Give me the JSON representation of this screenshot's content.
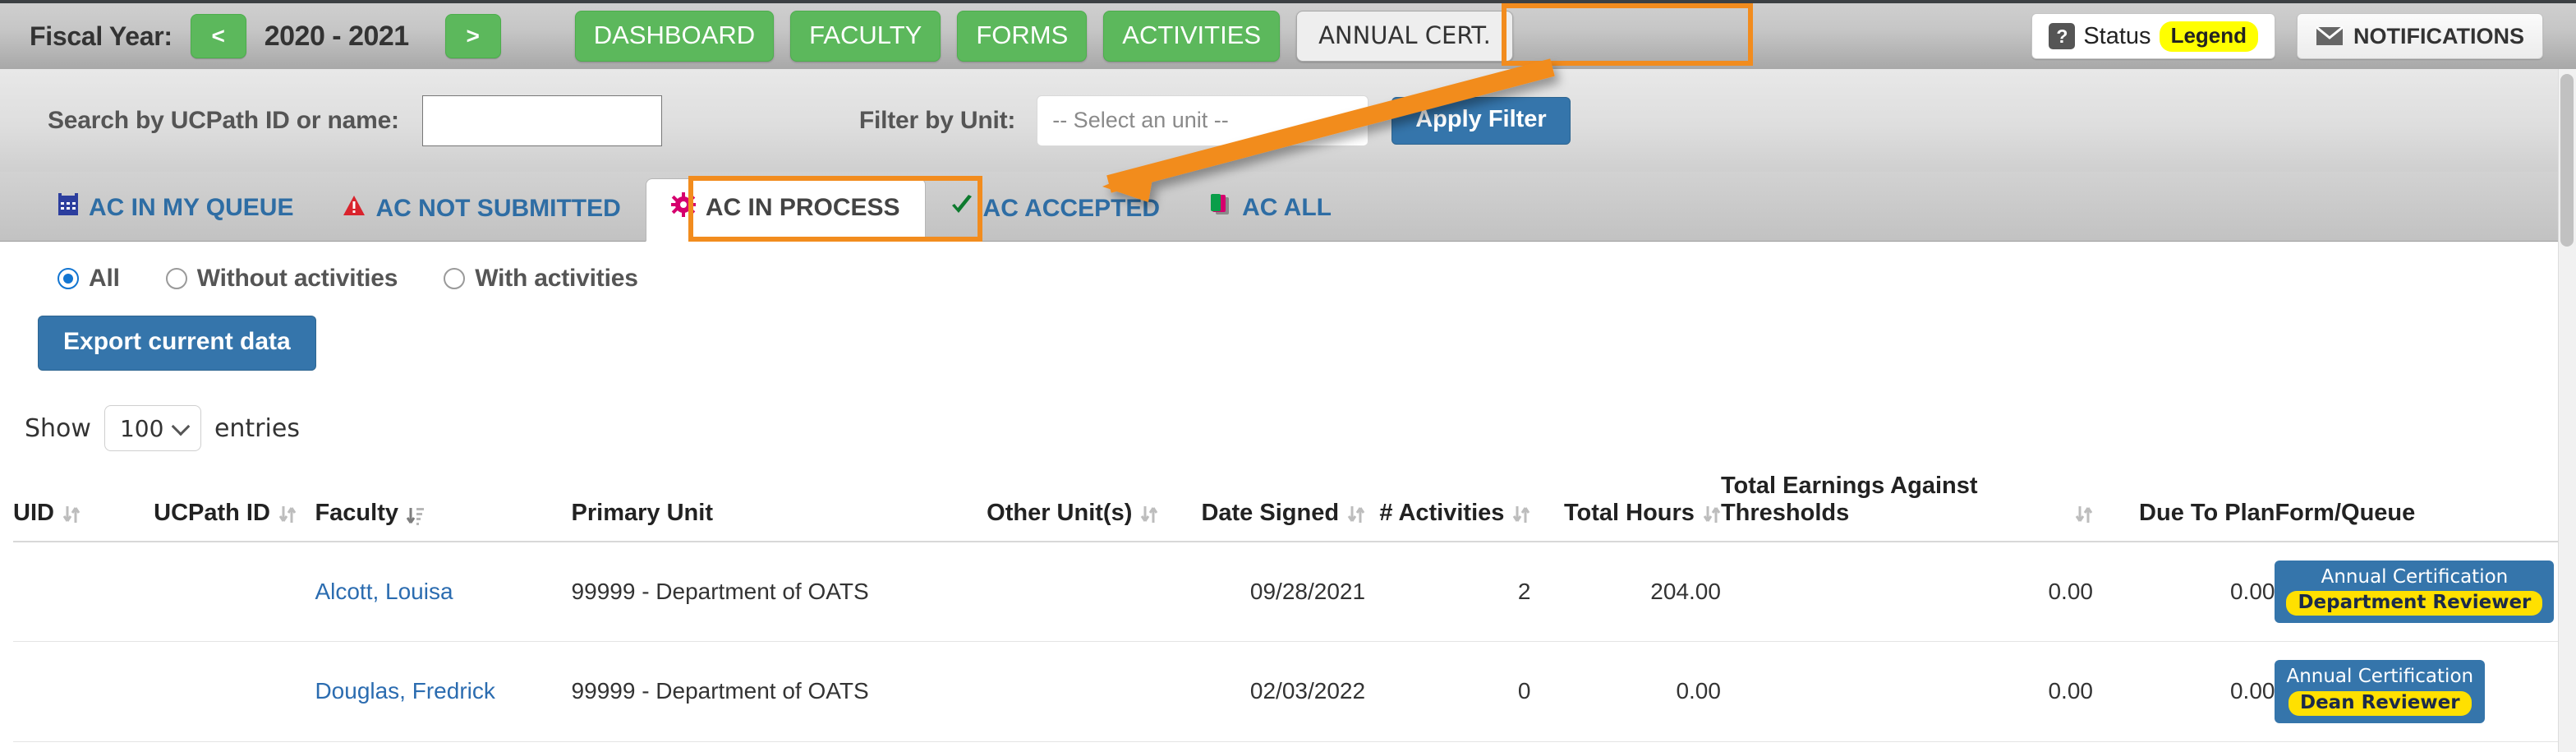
{
  "header": {
    "fiscal_year_label": "Fiscal Year:",
    "prev_label": "<",
    "next_label": ">",
    "fiscal_year_value": "2020 - 2021",
    "nav_tabs": [
      {
        "label": "DASHBOARD",
        "active": false
      },
      {
        "label": "FACULTY",
        "active": false
      },
      {
        "label": "FORMS",
        "active": false
      },
      {
        "label": "ACTIVITIES",
        "active": false
      },
      {
        "label": "ANNUAL CERT.",
        "active": true
      }
    ],
    "status_label": "Status",
    "legend_label": "Legend",
    "notifications_label": "NOTIFICATIONS"
  },
  "filters": {
    "search_label": "Search by UCPath ID or name:",
    "search_value": "",
    "search_placeholder": "",
    "unit_label": "Filter by Unit:",
    "unit_selected": "-- Select an unit --",
    "apply_label": "Apply Filter"
  },
  "subtabs": [
    {
      "label": "AC IN MY QUEUE",
      "icon": "calendar-icon",
      "active": false
    },
    {
      "label": "AC NOT SUBMITTED",
      "icon": "warning-triangle-icon",
      "active": false
    },
    {
      "label": "AC IN PROCESS",
      "icon": "gear-icon",
      "active": true
    },
    {
      "label": "AC ACCEPTED",
      "icon": "check-icon",
      "active": false
    },
    {
      "label": "AC ALL",
      "icon": "copy-icon",
      "active": false
    }
  ],
  "activity_filter": {
    "options": [
      {
        "label": "All",
        "checked": true
      },
      {
        "label": "Without activities",
        "checked": false
      },
      {
        "label": "With activities",
        "checked": false
      }
    ]
  },
  "export_label": "Export current data",
  "paging": {
    "show_label": "Show",
    "entries_value": "100",
    "entries_label": "entries"
  },
  "table": {
    "columns": [
      {
        "label": "UID",
        "sortable": true,
        "sort": "none",
        "align": "left"
      },
      {
        "label": "UCPath ID",
        "sortable": true,
        "sort": "none",
        "align": "left"
      },
      {
        "label": "Faculty",
        "sortable": true,
        "sort": "asc",
        "align": "left"
      },
      {
        "label": "Primary Unit",
        "sortable": false,
        "sort": "none",
        "align": "left"
      },
      {
        "label": "Other Unit(s)",
        "sortable": true,
        "sort": "none",
        "align": "right"
      },
      {
        "label": "Date Signed",
        "sortable": true,
        "sort": "none",
        "align": "right"
      },
      {
        "label": "# Activities",
        "sortable": true,
        "sort": "none",
        "align": "right"
      },
      {
        "label": "Total Hours",
        "sortable": true,
        "sort": "none",
        "align": "right"
      },
      {
        "label": "Total Earnings Against Thresholds",
        "sortable": true,
        "sort": "none",
        "align": "right"
      },
      {
        "label": "Due To Plan",
        "sortable": false,
        "sort": "none",
        "align": "right"
      },
      {
        "label": "Form/Queue",
        "sortable": false,
        "sort": "none",
        "align": "left"
      }
    ],
    "rows": [
      {
        "uid": "",
        "ucpath_id": "",
        "faculty": "Alcott, Louisa",
        "primary_unit": "99999 - Department of OATS",
        "other_units": "",
        "date_signed": "09/28/2021",
        "activities": "2",
        "total_hours": "204.00",
        "total_earnings": "0.00",
        "due_to_plan": "0.00",
        "form_title": "Annual Certification",
        "form_queue": "Department Reviewer"
      },
      {
        "uid": "",
        "ucpath_id": "",
        "faculty": "Douglas, Fredrick",
        "primary_unit": "99999 - Department of OATS",
        "other_units": "",
        "date_signed": "02/03/2022",
        "activities": "0",
        "total_hours": "0.00",
        "total_earnings": "0.00",
        "due_to_plan": "0.00",
        "form_title": "Annual Certification",
        "form_queue": "Dean Reviewer"
      }
    ]
  },
  "colors": {
    "green": "#5cb85c",
    "blue": "#3575ab",
    "link_blue": "#2e6da4",
    "annotation_orange": "#f28c1e",
    "yellow": "#ffe000",
    "legend_yellow": "#ffff00"
  }
}
